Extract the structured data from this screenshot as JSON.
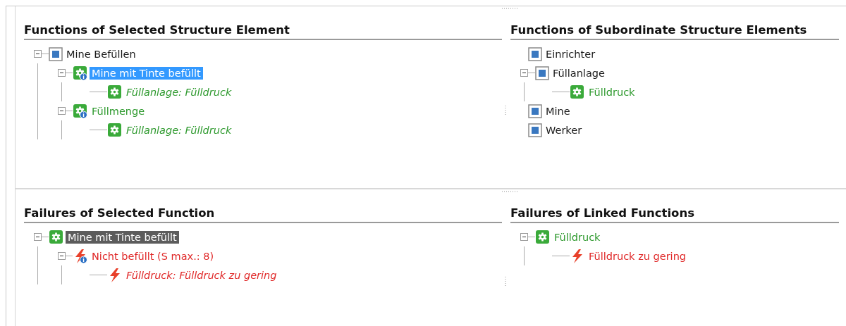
{
  "panels": [
    {
      "title": "Functions of Selected Structure Element",
      "focused": true,
      "nodes": [
        {
          "label": "Mine Befüllen",
          "kind": "element",
          "selected": false,
          "expanded": true,
          "children": [
            {
              "label": "Mine mit Tinte befüllt",
              "kind": "function-info",
              "selected": true,
              "expanded": true,
              "children": [
                {
                  "label": "Füllanlage: Fülldruck",
                  "kind": "linked-function",
                  "selected": false
                }
              ]
            },
            {
              "label": "Füllmenge",
              "kind": "function-info",
              "selected": false,
              "expanded": true,
              "children": [
                {
                  "label": "Füllanlage: Fülldruck",
                  "kind": "linked-function",
                  "selected": false
                }
              ]
            }
          ]
        }
      ]
    },
    {
      "title": "Functions of Subordinate Structure Elements",
      "focused": false,
      "nodes": [
        {
          "label": "Einrichter",
          "kind": "element",
          "selected": false
        },
        {
          "label": "Füllanlage",
          "kind": "element",
          "selected": false,
          "expanded": true,
          "children": [
            {
              "label": "Fülldruck",
              "kind": "function",
              "selected": false
            }
          ]
        },
        {
          "label": "Mine",
          "kind": "element",
          "selected": false
        },
        {
          "label": "Werker",
          "kind": "element",
          "selected": false
        }
      ]
    },
    {
      "title": "Failures of Selected Function",
      "focused": false,
      "nodes": [
        {
          "label": "Mine mit Tinte befüllt",
          "kind": "function",
          "selected": true,
          "expanded": true,
          "children": [
            {
              "label": "Nicht befüllt (S max.: 8)",
              "kind": "failure-info",
              "selected": false,
              "expanded": true,
              "children": [
                {
                  "label": "Fülldruck: Fülldruck zu gering",
                  "kind": "linked-failure",
                  "selected": false
                }
              ]
            }
          ]
        }
      ]
    },
    {
      "title": "Failures of Linked Functions",
      "focused": false,
      "nodes": [
        {
          "label": "Fülldruck",
          "kind": "function",
          "selected": false,
          "expanded": true,
          "children": [
            {
              "label": "Fülldruck zu gering",
              "kind": "failure",
              "selected": false
            }
          ]
        }
      ]
    }
  ]
}
